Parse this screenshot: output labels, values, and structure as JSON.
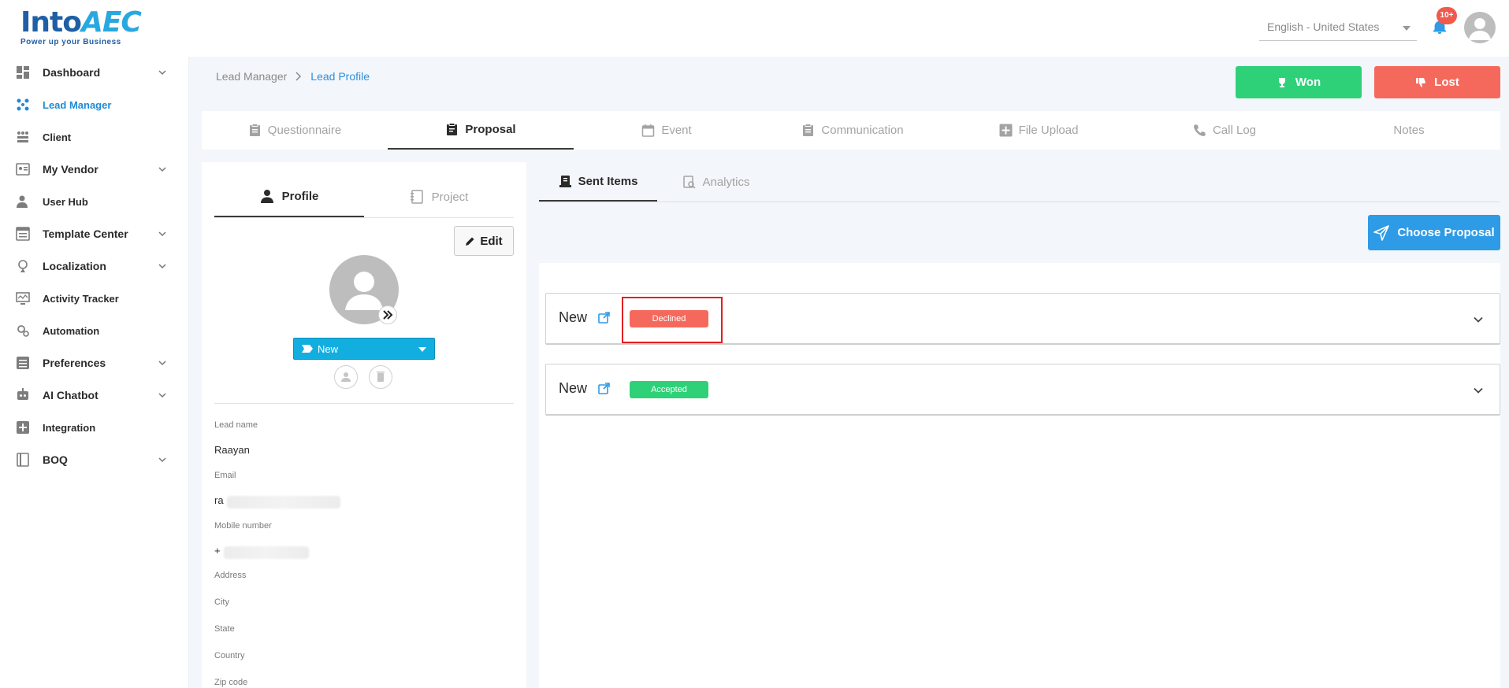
{
  "header": {
    "logo_main": "Into",
    "logo_accent": "AEC",
    "logo_tagline": "Power up your Business",
    "language": "English - United States",
    "notification_count": "10+"
  },
  "sidebar": {
    "items": [
      {
        "label": "Dashboard"
      },
      {
        "label": "Lead Manager"
      },
      {
        "label": "Client"
      },
      {
        "label": "My Vendor"
      },
      {
        "label": "User Hub"
      },
      {
        "label": "Template Center"
      },
      {
        "label": "Localization"
      },
      {
        "label": "Activity Tracker"
      },
      {
        "label": "Automation"
      },
      {
        "label": "Preferences"
      },
      {
        "label": "AI Chatbot"
      },
      {
        "label": "Integration"
      },
      {
        "label": "BOQ"
      }
    ]
  },
  "breadcrumb": {
    "parent": "Lead Manager",
    "current": "Lead Profile"
  },
  "actions": {
    "won": "Won",
    "lost": "Lost"
  },
  "tabs": [
    {
      "label": "Questionnaire"
    },
    {
      "label": "Proposal"
    },
    {
      "label": "Event"
    },
    {
      "label": "Communication"
    },
    {
      "label": "File Upload"
    },
    {
      "label": "Call Log"
    },
    {
      "label": "Notes"
    }
  ],
  "profile": {
    "tabs": [
      {
        "label": "Profile"
      },
      {
        "label": "Project"
      }
    ],
    "edit_label": "Edit",
    "status": "New",
    "fields": [
      {
        "label": "Lead name",
        "value": "Raayan"
      },
      {
        "label": "Email",
        "value": "ra"
      },
      {
        "label": "Mobile number",
        "value": "+"
      },
      {
        "label": "Address",
        "value": ""
      },
      {
        "label": "City",
        "value": ""
      },
      {
        "label": "State",
        "value": ""
      },
      {
        "label": "Country",
        "value": ""
      },
      {
        "label": "Zip code",
        "value": ""
      }
    ]
  },
  "proposal": {
    "subtabs": [
      {
        "label": "Sent Items"
      },
      {
        "label": "Analytics"
      }
    ],
    "choose_label": "Choose Proposal",
    "items": [
      {
        "title": "New",
        "status": "Declined"
      },
      {
        "title": "New",
        "status": "Accepted"
      }
    ]
  },
  "colors": {
    "won": "#2ed178",
    "lost": "#f5695c",
    "primary": "#2d9be6",
    "status_select": "#13aee0",
    "highlight": "#e02020"
  }
}
